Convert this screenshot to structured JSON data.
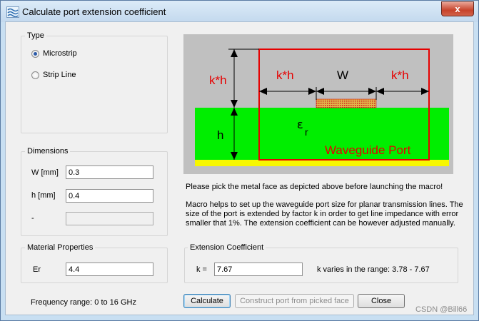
{
  "window": {
    "title": "Calculate port extension coefficient",
    "close_glyph": "x"
  },
  "type_group": {
    "label": "Type",
    "options": [
      {
        "label": "Microstrip",
        "selected": true
      },
      {
        "label": "Strip Line",
        "selected": false
      }
    ]
  },
  "dimensions": {
    "label": "Dimensions",
    "w_label": "W [mm]",
    "w_value": "0.3",
    "h_label": "h [mm]",
    "h_value": "0.4",
    "extra_label": "-",
    "extra_value": ""
  },
  "material": {
    "label": "Material Properties",
    "er_label": "Er",
    "er_value": "4.4"
  },
  "frequency_text": "Frequency range: 0 to 16 GHz",
  "diagram": {
    "kh_left": "k*h",
    "kh_mid": "k*h",
    "w": "W",
    "kh_right": "k*h",
    "h": "h",
    "epsilon": "ε",
    "epsilon_sub": "r",
    "port_label": "Waveguide Port",
    "colors": {
      "background": "#c0c0c0",
      "substrate": "#00ee00",
      "ground": "#f7f700",
      "port": "#e60000",
      "strip": "#e2b44b"
    }
  },
  "instructions": {
    "pick": "Please pick the metal face as depicted above before launching the macro!",
    "help_lines": [
      "Macro helps to set up the waveguide port size for planar transmission lines. The",
      "size of the port is extended by factor k in order to get line impedance with error",
      "smaller that 1%. The extension coefficient can be however adjusted manually."
    ]
  },
  "extension": {
    "label": "Extension Coefficient",
    "k_label": "k =",
    "k_value": "7.67",
    "range_text": "k varies in the range: 3.78 - 7.67"
  },
  "buttons": {
    "calculate": "Calculate",
    "construct": "Construct port from picked face",
    "close": "Close"
  },
  "watermark": "CSDN @Bill66"
}
